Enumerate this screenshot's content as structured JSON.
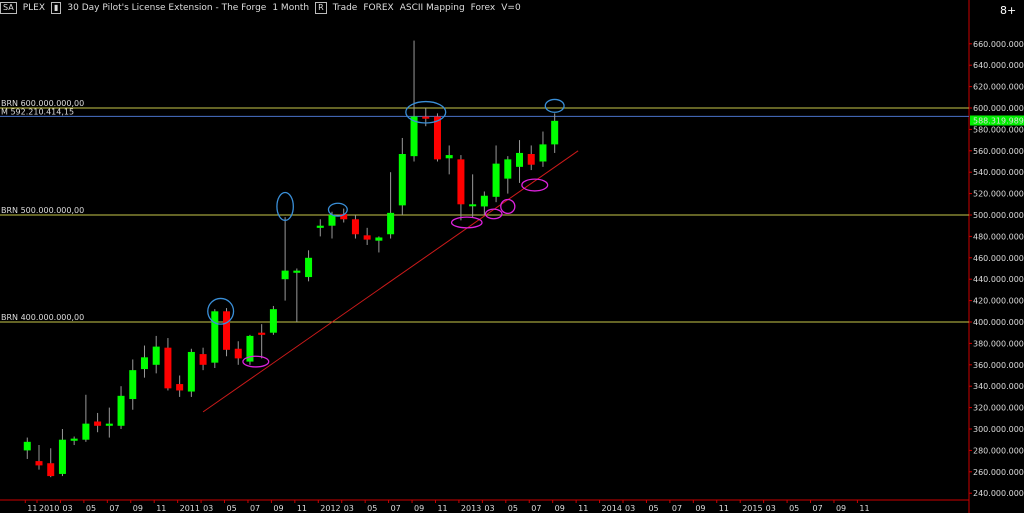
{
  "header": {
    "symbol_box": "SA",
    "symbol": "PLEX",
    "bar_icon": "bar-chart-icon",
    "instrument": "30 Day Pilot's License Extension - The Forge",
    "interval": "1 Month",
    "r_box": "R",
    "mode": "Trade",
    "market": "FOREX",
    "mapping": "ASCII Mapping",
    "market2": "Forex",
    "volume": "V=0",
    "plus_label": "8+"
  },
  "colors": {
    "up": "#00ff00",
    "down": "#ff0000",
    "level": "#c8c84a",
    "current": "#4a73c8",
    "trend": "#cc1a1a",
    "annot_blue": "#3a8fd8",
    "annot_magenta": "#dd22dd",
    "price_tag": "#00ee00"
  },
  "levels": [
    {
      "label": "BRN 600.000.000,00",
      "value": 600000000
    },
    {
      "label": "BRN 500.000.000,00",
      "value": 500000000
    },
    {
      "label": "BRN 400.000.000,00",
      "value": 400000000
    }
  ],
  "current_line": {
    "label": "M 592.210.414,15",
    "value": 592210414
  },
  "last_price_tag": "588.319.989,9",
  "chart_data": {
    "type": "candlestick",
    "ylim": [
      235000000,
      675000000
    ],
    "y_ticks": [
      "660.000.000,00",
      "640.000.000,00",
      "620.000.000,00",
      "600.000.000,00",
      "580.000.000,00",
      "560.000.000,00",
      "540.000.000,00",
      "520.000.000,00",
      "500.000.000,00",
      "480.000.000,00",
      "460.000.000,00",
      "440.000.000,00",
      "420.000.000,00",
      "400.000.000,00",
      "380.000.000,00",
      "360.000.000,00",
      "340.000.000,00",
      "320.000.000,00",
      "300.000.000,00",
      "280.000.000,00",
      "260.000.000,00",
      "240.000.000,00"
    ],
    "y_tick_values": [
      660000000,
      640000000,
      620000000,
      600000000,
      580000000,
      560000000,
      540000000,
      520000000,
      500000000,
      480000000,
      460000000,
      440000000,
      420000000,
      400000000,
      380000000,
      360000000,
      340000000,
      320000000,
      300000000,
      280000000,
      260000000,
      240000000
    ],
    "x_labels": [
      "11",
      "2010",
      "03",
      "05",
      "07",
      "09",
      "11",
      "2011",
      "03",
      "05",
      "07",
      "09",
      "11",
      "2012",
      "03",
      "05",
      "07",
      "09",
      "11",
      "2013",
      "03",
      "05",
      "07",
      "09",
      "11",
      "2014",
      "03",
      "05",
      "07",
      "09",
      "11",
      "2015",
      "03",
      "05",
      "07",
      "09",
      "11"
    ],
    "x_label_months": [
      -1,
      0,
      2,
      4,
      6,
      8,
      10,
      12,
      14,
      16,
      18,
      20,
      22,
      24,
      26,
      28,
      30,
      32,
      34,
      36,
      38,
      40,
      42,
      44,
      46,
      48,
      50,
      52,
      54,
      56,
      58,
      60,
      62,
      64,
      66,
      68,
      70
    ],
    "candles": [
      {
        "m": -1,
        "o": 280000000,
        "h": 292000000,
        "l": 272000000,
        "c": 288000000
      },
      {
        "m": 0,
        "o": 270000000,
        "h": 285000000,
        "l": 262000000,
        "c": 266000000
      },
      {
        "m": 1,
        "o": 268000000,
        "h": 282000000,
        "l": 255000000,
        "c": 256000000
      },
      {
        "m": 2,
        "o": 258000000,
        "h": 300000000,
        "l": 256000000,
        "c": 290000000
      },
      {
        "m": 3,
        "o": 289000000,
        "h": 293000000,
        "l": 285000000,
        "c": 291000000
      },
      {
        "m": 4,
        "o": 290000000,
        "h": 332000000,
        "l": 288000000,
        "c": 305000000
      },
      {
        "m": 5,
        "o": 307000000,
        "h": 315000000,
        "l": 297000000,
        "c": 303000000
      },
      {
        "m": 6,
        "o": 303000000,
        "h": 320000000,
        "l": 292000000,
        "c": 305000000
      },
      {
        "m": 7,
        "o": 303000000,
        "h": 340000000,
        "l": 300000000,
        "c": 331000000
      },
      {
        "m": 8,
        "o": 328000000,
        "h": 365000000,
        "l": 318000000,
        "c": 355000000
      },
      {
        "m": 9,
        "o": 356000000,
        "h": 378000000,
        "l": 348000000,
        "c": 367000000
      },
      {
        "m": 10,
        "o": 360000000,
        "h": 387000000,
        "l": 352000000,
        "c": 377000000
      },
      {
        "m": 11,
        "o": 376000000,
        "h": 385000000,
        "l": 336000000,
        "c": 338000000
      },
      {
        "m": 12,
        "o": 342000000,
        "h": 350000000,
        "l": 330000000,
        "c": 336000000
      },
      {
        "m": 13,
        "o": 335000000,
        "h": 375000000,
        "l": 330000000,
        "c": 372000000
      },
      {
        "m": 14,
        "o": 370000000,
        "h": 376000000,
        "l": 355000000,
        "c": 360000000
      },
      {
        "m": 15,
        "o": 362000000,
        "h": 412000000,
        "l": 357000000,
        "c": 410000000
      },
      {
        "m": 16,
        "o": 410000000,
        "h": 413000000,
        "l": 368000000,
        "c": 374000000
      },
      {
        "m": 17,
        "o": 375000000,
        "h": 382000000,
        "l": 360000000,
        "c": 366000000
      },
      {
        "m": 18,
        "o": 363000000,
        "h": 388000000,
        "l": 360000000,
        "c": 387000000
      },
      {
        "m": 19,
        "o": 390000000,
        "h": 398000000,
        "l": 366000000,
        "c": 388000000
      },
      {
        "m": 20,
        "o": 390000000,
        "h": 415000000,
        "l": 388000000,
        "c": 412000000
      },
      {
        "m": 21,
        "o": 440000000,
        "h": 498000000,
        "l": 420000000,
        "c": 448000000
      },
      {
        "m": 22,
        "o": 446000000,
        "h": 450000000,
        "l": 400000000,
        "c": 448000000
      },
      {
        "m": 23,
        "o": 442000000,
        "h": 467000000,
        "l": 438000000,
        "c": 460000000
      },
      {
        "m": 24,
        "o": 488000000,
        "h": 496000000,
        "l": 480000000,
        "c": 490000000
      },
      {
        "m": 25,
        "o": 490000000,
        "h": 503000000,
        "l": 478000000,
        "c": 500000000
      },
      {
        "m": 26,
        "o": 501000000,
        "h": 506000000,
        "l": 493000000,
        "c": 496000000
      },
      {
        "m": 27,
        "o": 496000000,
        "h": 500000000,
        "l": 478000000,
        "c": 482000000
      },
      {
        "m": 28,
        "o": 481000000,
        "h": 488000000,
        "l": 472000000,
        "c": 477000000
      },
      {
        "m": 29,
        "o": 476000000,
        "h": 480000000,
        "l": 465000000,
        "c": 479000000
      },
      {
        "m": 30,
        "o": 482000000,
        "h": 540000000,
        "l": 478000000,
        "c": 502000000
      },
      {
        "m": 31,
        "o": 509000000,
        "h": 572000000,
        "l": 500000000,
        "c": 557000000
      },
      {
        "m": 32,
        "o": 555000000,
        "h": 663000000,
        "l": 550000000,
        "c": 592000000
      },
      {
        "m": 33,
        "o": 592000000,
        "h": 600000000,
        "l": 583000000,
        "c": 590000000
      },
      {
        "m": 34,
        "o": 592000000,
        "h": 595000000,
        "l": 550000000,
        "c": 552000000
      },
      {
        "m": 35,
        "o": 553000000,
        "h": 565000000,
        "l": 538000000,
        "c": 556000000
      },
      {
        "m": 36,
        "o": 552000000,
        "h": 556000000,
        "l": 495000000,
        "c": 510000000
      },
      {
        "m": 37,
        "o": 510000000,
        "h": 538000000,
        "l": 498000000,
        "c": 510000000
      },
      {
        "m": 38,
        "o": 508000000,
        "h": 522000000,
        "l": 500000000,
        "c": 518000000
      },
      {
        "m": 39,
        "o": 517000000,
        "h": 565000000,
        "l": 512000000,
        "c": 548000000
      },
      {
        "m": 40,
        "o": 534000000,
        "h": 555000000,
        "l": 520000000,
        "c": 552000000
      },
      {
        "m": 41,
        "o": 545000000,
        "h": 570000000,
        "l": 530000000,
        "c": 558000000
      },
      {
        "m": 42,
        "o": 557000000,
        "h": 565000000,
        "l": 542000000,
        "c": 547000000
      },
      {
        "m": 43,
        "o": 550000000,
        "h": 578000000,
        "l": 545000000,
        "c": 566000000
      },
      {
        "m": 44,
        "o": 566000000,
        "h": 595000000,
        "l": 558000000,
        "c": 588000000
      }
    ],
    "trendline": {
      "from": {
        "m": 14,
        "v": 316000000
      },
      "to": {
        "m": 46,
        "v": 560000000
      }
    },
    "annotations": [
      {
        "shape": "ellipse",
        "color": "blue",
        "m": 21,
        "v": 508000000,
        "rm": 0.7,
        "rv": 13000000
      },
      {
        "shape": "ellipse",
        "color": "blue",
        "m": 25.5,
        "v": 505000000,
        "rm": 0.8,
        "rv": 6000000
      },
      {
        "shape": "ellipse",
        "color": "blue",
        "m": 15.5,
        "v": 410000000,
        "rm": 1.1,
        "rv": 12000000
      },
      {
        "shape": "ellipse",
        "color": "blue",
        "m": 33,
        "v": 596000000,
        "rm": 1.7,
        "rv": 10000000
      },
      {
        "shape": "ellipse",
        "color": "blue",
        "m": 44,
        "v": 602000000,
        "rm": 0.8,
        "rv": 6000000
      },
      {
        "shape": "ellipse",
        "color": "magenta",
        "m": 18.5,
        "v": 363000000,
        "rm": 1.1,
        "rv": 5000000
      },
      {
        "shape": "ellipse",
        "color": "magenta",
        "m": 36.5,
        "v": 493000000,
        "rm": 1.3,
        "rv": 5000000
      },
      {
        "shape": "ellipse",
        "color": "magenta",
        "m": 38.8,
        "v": 501000000,
        "rm": 0.7,
        "rv": 4500000
      },
      {
        "shape": "ellipse",
        "color": "magenta",
        "m": 40,
        "v": 508000000,
        "rm": 0.6,
        "rv": 6500000
      },
      {
        "shape": "ellipse",
        "color": "magenta",
        "m": 42.3,
        "v": 528000000,
        "rm": 1.1,
        "rv": 5500000
      }
    ]
  }
}
